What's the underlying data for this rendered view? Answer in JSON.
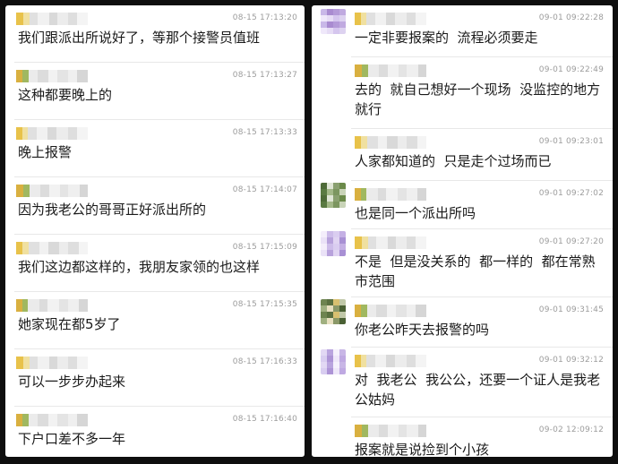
{
  "left_messages": [
    {
      "time": "08-15 17:13:20",
      "text": "我们跟派出所说好了，等那个接警员值班"
    },
    {
      "time": "08-15 17:13:27",
      "text": "这种都要晚上的"
    },
    {
      "time": "08-15 17:13:33",
      "text": "晚上报警"
    },
    {
      "time": "08-15 17:14:07",
      "text": "因为我老公的哥哥正好派出所的"
    },
    {
      "time": "08-15 17:15:09",
      "text": "我们这边都这样的，我朋友家领的也这样"
    },
    {
      "time": "08-15 17:15:35",
      "text": "她家现在都5岁了"
    },
    {
      "time": "08-15 17:16:33",
      "text": "可以一步步办起来"
    },
    {
      "time": "08-15 17:16:40",
      "text": "下户口差不多一年"
    }
  ],
  "right_messages": [
    {
      "time": "09-01 09:22:28",
      "text": "一定非要报案的  流程必须要走"
    },
    {
      "time": "09-01 09:22:49",
      "text": "去的  就自己想好一个现场  没监控的地方就行"
    },
    {
      "time": "09-01 09:23:01",
      "text": "人家都知道的  只是走个过场而已"
    },
    {
      "time": "09-01 09:27:02",
      "text": "也是同一个派出所吗"
    },
    {
      "time": "09-01 09:27:20",
      "text": "不是  但是没关系的  都一样的  都在常熟市范围"
    },
    {
      "time": "09-01 09:31:45",
      "text": "你老公昨天去报警的吗"
    },
    {
      "time": "09-01 09:32:12",
      "text": "对  我老公  我公公，还要一个证人是我老公姑妈"
    },
    {
      "time": "09-02 12:09:12",
      "text": "报案就是说捡到个小孩"
    }
  ],
  "colors": {
    "background": "#0e0e0e",
    "panel": "#ffffff",
    "timestamp": "#9c9c9c",
    "message_text": "#1a1a1a",
    "divider": "#e8e8e8"
  }
}
